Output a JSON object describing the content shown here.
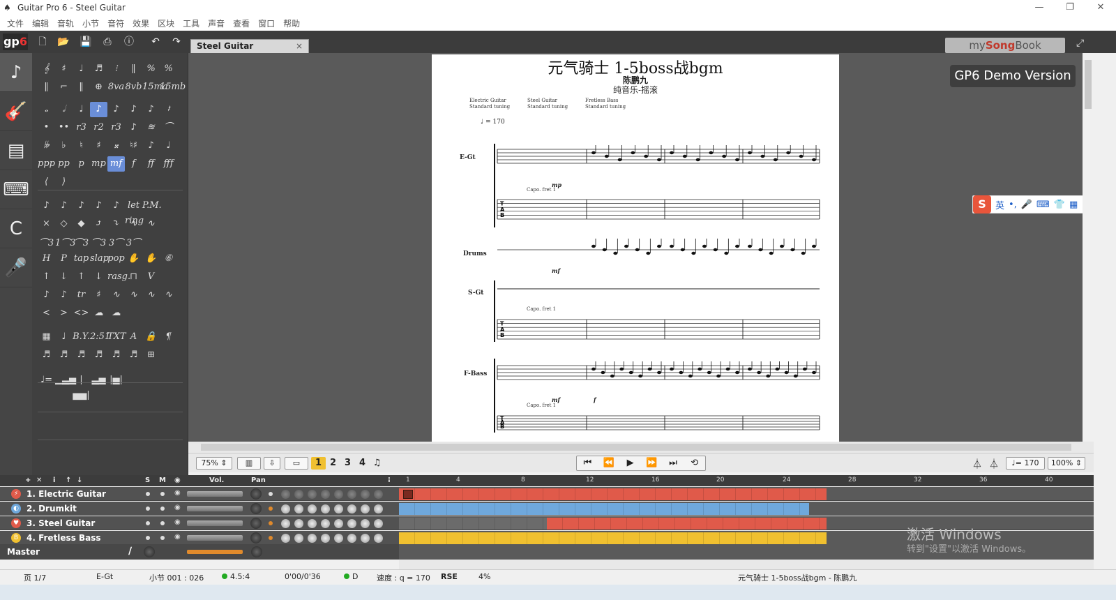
{
  "window": {
    "title": "Guitar Pro 6 - Steel Guitar",
    "controls": [
      "—",
      "❐",
      "✕"
    ]
  },
  "menu": [
    "文件",
    "编辑",
    "音轨",
    "小节",
    "音符",
    "效果",
    "区块",
    "工具",
    "声音",
    "查看",
    "窗口",
    "帮助"
  ],
  "toolbar": {
    "logo_a": "gp",
    "logo_b": "6",
    "doc_tab": "Steel Guitar",
    "doc_tab_close": "×",
    "mysongbook_a": "my",
    "mysongbook_b": "Song",
    "mysongbook_c": "Book"
  },
  "demo_badge": "GP6 Demo Version",
  "palette": {
    "rows": [
      [
        "𝄞",
        "♯",
        "♩",
        "♬",
        "⁝",
        "‖",
        "%",
        "%"
      ],
      [
        "‖",
        "⌐",
        "‖",
        "⊕",
        "8va",
        "8vb",
        "15ma",
        "15mb"
      ],
      [
        "𝅝",
        "𝅗𝅥",
        "♩",
        "♪",
        "♪",
        "♪",
        "♪",
        "𝄽"
      ],
      [
        "•",
        "••",
        "r3",
        "r2",
        "r3",
        "♪",
        "≋",
        "⌒"
      ],
      [
        "𝄫",
        "♭",
        "♮",
        "♯",
        "𝄪",
        "♮♯",
        "♪",
        "♩"
      ],
      [
        "ppp",
        "pp",
        "p",
        "mp",
        "mf",
        "f",
        "ff",
        "fff"
      ],
      [
        "⟨",
        "⟩"
      ],
      [
        "♪",
        "♪",
        "♪",
        "♪",
        "♪",
        "let ring",
        "P.M."
      ],
      [
        "×",
        "◇",
        "◆",
        "⤴",
        "⤵",
        "∿",
        "∿"
      ],
      [
        "⌒3",
        "1⌒3",
        "⌒3",
        "⌒3",
        "3⌒",
        "3⌒"
      ],
      [
        "H",
        "P",
        "tap",
        "slap",
        "pop",
        "✋",
        "✋",
        "⑥"
      ],
      [
        "↑",
        "↓",
        "↑",
        "↓",
        "rasg.",
        "⊓",
        "V"
      ],
      [
        "♪",
        "♪",
        "tr",
        "♯",
        "∿",
        "∿",
        "∿",
        "∿"
      ],
      [
        "<",
        ">",
        "<>",
        "☁",
        "☁"
      ],
      [
        "▦",
        "♩",
        "B.Y.",
        "2:51",
        "TXT",
        "A",
        "🔒",
        "¶"
      ],
      [
        "♬",
        "♬",
        "♬",
        "♬",
        "♬",
        "♬",
        "⊞"
      ],
      [
        "♩=",
        "▁▃▅",
        "|▅▅|",
        "▃▅",
        "|▅|"
      ]
    ]
  },
  "score": {
    "title": "元气骑士 1-5boss战bgm",
    "artist": "陈鹏九",
    "subtitle": "纯音乐-摇滚",
    "tunings": [
      {
        "name": "Electric Guitar",
        "tuning": "Standard tuning"
      },
      {
        "name": "Steel Guitar",
        "tuning": "Standard tuning"
      },
      {
        "name": "Fretless Bass",
        "tuning": "Standard tuning"
      }
    ],
    "tempo": "♩ = 170",
    "instruments": [
      "E-Gt",
      "Drums",
      "S-Gt",
      "F-Bass"
    ],
    "capo": "Capo. fret 1",
    "dynamics": [
      "mp",
      "mf",
      "mf",
      "f"
    ],
    "tab_numbers_a": [
      "0",
      "2 2 2",
      "0",
      "0",
      "0",
      "x",
      "0",
      "x",
      "2",
      "x",
      "4",
      "4",
      "2",
      "1"
    ],
    "tab_numbers_b": [
      "2"
    ]
  },
  "ime": {
    "logo": "S",
    "lang": "英",
    "punct": "•,",
    "icons": [
      "🎤",
      "⌨",
      "👕",
      "▦"
    ]
  },
  "transport": {
    "zoom": "75%",
    "layout": "▥",
    "voices": [
      "1",
      "2",
      "3",
      "4"
    ],
    "controls": [
      "⏮",
      "⏪",
      "▶",
      "⏩",
      "⏭",
      "⟲"
    ],
    "tempo": "♩= 170",
    "speed": "100%"
  },
  "tracks_header": {
    "buttons": [
      "+",
      "✕",
      "i",
      "↑",
      "↓"
    ],
    "solo": "S",
    "mute": "M",
    "vol": "Vol.",
    "pan": "Pan"
  },
  "timeline": [
    "1",
    "4",
    "8",
    "12",
    "16",
    "20",
    "24",
    "28",
    "32",
    "36",
    "40"
  ],
  "tracks": [
    {
      "name": "1. Electric Guitar",
      "color": "#e05a4a",
      "icon": "⚡",
      "blocks": [
        {
          "start": 0.0,
          "end": 0.615,
          "color": "#e05a4a"
        }
      ]
    },
    {
      "name": "2. Drumkit",
      "color": "#6fa8dc",
      "icon": "◐",
      "blocks": [
        {
          "start": 0.0,
          "end": 0.59,
          "color": "#6fa8dc"
        }
      ]
    },
    {
      "name": "3. Steel Guitar",
      "color": "#e05a4a",
      "icon": "♥",
      "blocks": [
        {
          "start": 0.0,
          "end": 0.213,
          "color": "#6b6b6b"
        },
        {
          "start": 0.213,
          "end": 0.615,
          "color": "#e05a4a"
        }
      ]
    },
    {
      "name": "4. Fretless Bass",
      "color": "#f0c030",
      "icon": "B",
      "blocks": [
        {
          "start": 0.0,
          "end": 0.615,
          "color": "#f0c030"
        }
      ]
    }
  ],
  "master": {
    "name": "Master"
  },
  "activate": {
    "line1": "激活 Windows",
    "line2": "转到\"设置\"以激活 Windows。"
  },
  "status": {
    "page": "页 1/7",
    "track": "E-Gt",
    "bar": "小节 001 : 026",
    "time_sig": "4.5:4",
    "time": "0'00/0'36",
    "key": "D",
    "speed": "速度 : q = 170",
    "rse": "RSE",
    "cpu": "4%",
    "song": "元气骑士 1-5boss战bgm - 陈鹏九"
  }
}
